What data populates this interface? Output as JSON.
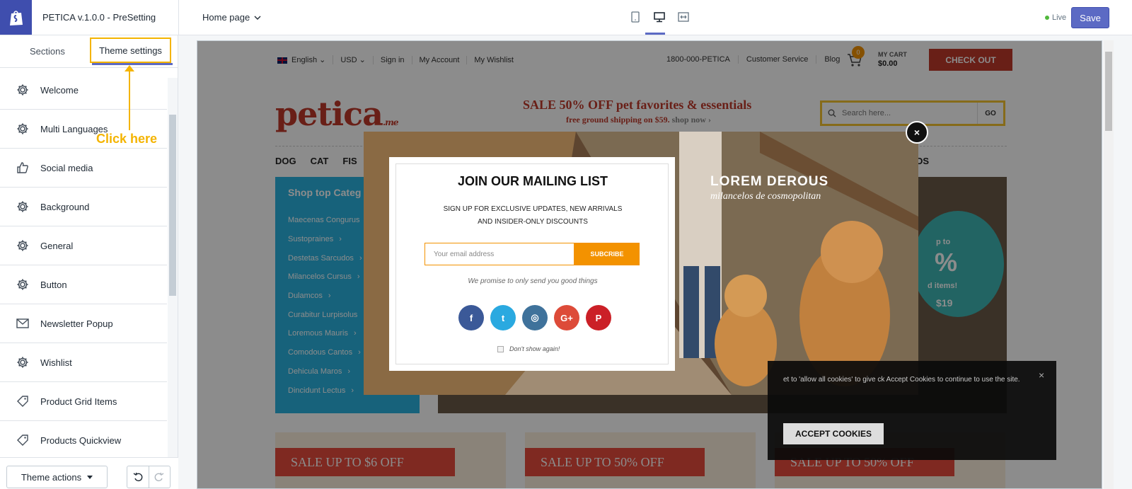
{
  "header": {
    "app_title": "PETICA v.1.0.0 - PreSetting",
    "page_select": "Home page",
    "live_label": "Live",
    "save_label": "Save"
  },
  "sidebar": {
    "tab_sections": "Sections",
    "tab_theme_settings": "Theme settings",
    "annotation": "Click here",
    "items": [
      {
        "label": "Welcome",
        "icon": "gear-icon"
      },
      {
        "label": "Multi Languages",
        "icon": "gear-icon"
      },
      {
        "label": "Social media",
        "icon": "thumbs-up-icon"
      },
      {
        "label": "Background",
        "icon": "gear-icon"
      },
      {
        "label": "General",
        "icon": "gear-icon"
      },
      {
        "label": "Button",
        "icon": "gear-icon"
      },
      {
        "label": "Newsletter Popup",
        "icon": "envelope-icon"
      },
      {
        "label": "Wishlist",
        "icon": "gear-icon"
      },
      {
        "label": "Product Grid Items",
        "icon": "tag-icon"
      },
      {
        "label": "Products Quickview",
        "icon": "tag-icon"
      }
    ],
    "theme_actions": "Theme actions"
  },
  "store": {
    "language": "English",
    "currency": "USD",
    "sign_in": "Sign in",
    "my_account": "My Account",
    "my_wishlist": "My Wishlist",
    "phone": "1800-000-PETICA",
    "customer_service": "Customer Service",
    "blog": "Blog",
    "cart_count": "0",
    "my_cart": "MY CART",
    "cart_total": "$0.00",
    "checkout": "CHECK OUT",
    "logo": "petica",
    "logo_suffix": ".me",
    "sale_title": "SALE 50% OFF pet favorites & essentials",
    "sale_sub": "free ground shipping on $59.",
    "sale_shop": "shop now ›",
    "search_placeholder": "Search here...",
    "search_go": "GO",
    "nav": [
      "DOG",
      "CAT",
      "FIS"
    ],
    "nav_right": "DS",
    "cat_title": "Shop top Categ",
    "categories": [
      "Maecenas Congurus",
      "Sustopraines",
      "Destetas Sarcudos",
      "Milancelos Cursus",
      "Dulamcos",
      "Curabitur Lurpisolus",
      "Loremous Mauris",
      "Comodous Cantos",
      "Dehicula Maros",
      "Dincidunt Lectus"
    ],
    "badge_top": "p to",
    "badge_pct": "%",
    "badge_mid": "d items!",
    "badge_price": "$19",
    "promos": [
      {
        "label": "SALE UP TO $6 OFF"
      },
      {
        "label": "SALE UP TO 50% OFF"
      },
      {
        "label": "SALE UP TO 50% OFF"
      }
    ]
  },
  "popup": {
    "title": "JOIN OUR MAILING LIST",
    "sub1": "SIGN UP FOR EXCLUSIVE UPDATES, NEW ARRIVALS",
    "sub2": "AND INSIDER-ONLY DISCOUNTS",
    "email_placeholder": "Your email address",
    "subscribe": "SUBCRIBE",
    "promise": "We promise to only send you good things",
    "dont_show": "Don't show again!",
    "photo_title": "LOREM DEROUS",
    "photo_sub": "milancelos de cosmopolitan",
    "close": "×",
    "socials": [
      {
        "icon": "facebook-icon",
        "glyph": "f",
        "color": "#3b5998"
      },
      {
        "icon": "twitter-icon",
        "glyph": "t",
        "color": "#2aa9e0"
      },
      {
        "icon": "instagram-icon",
        "glyph": "◎",
        "color": "#3f729b"
      },
      {
        "icon": "google-plus-icon",
        "glyph": "G+",
        "color": "#dd4b39"
      },
      {
        "icon": "pinterest-icon",
        "glyph": "P",
        "color": "#cb2027"
      }
    ]
  },
  "cookie": {
    "text": "et to 'allow all cookies' to give ck Accept Cookies to continue to use the site.",
    "accept": "ACCEPT COOKIES",
    "close": "×"
  }
}
